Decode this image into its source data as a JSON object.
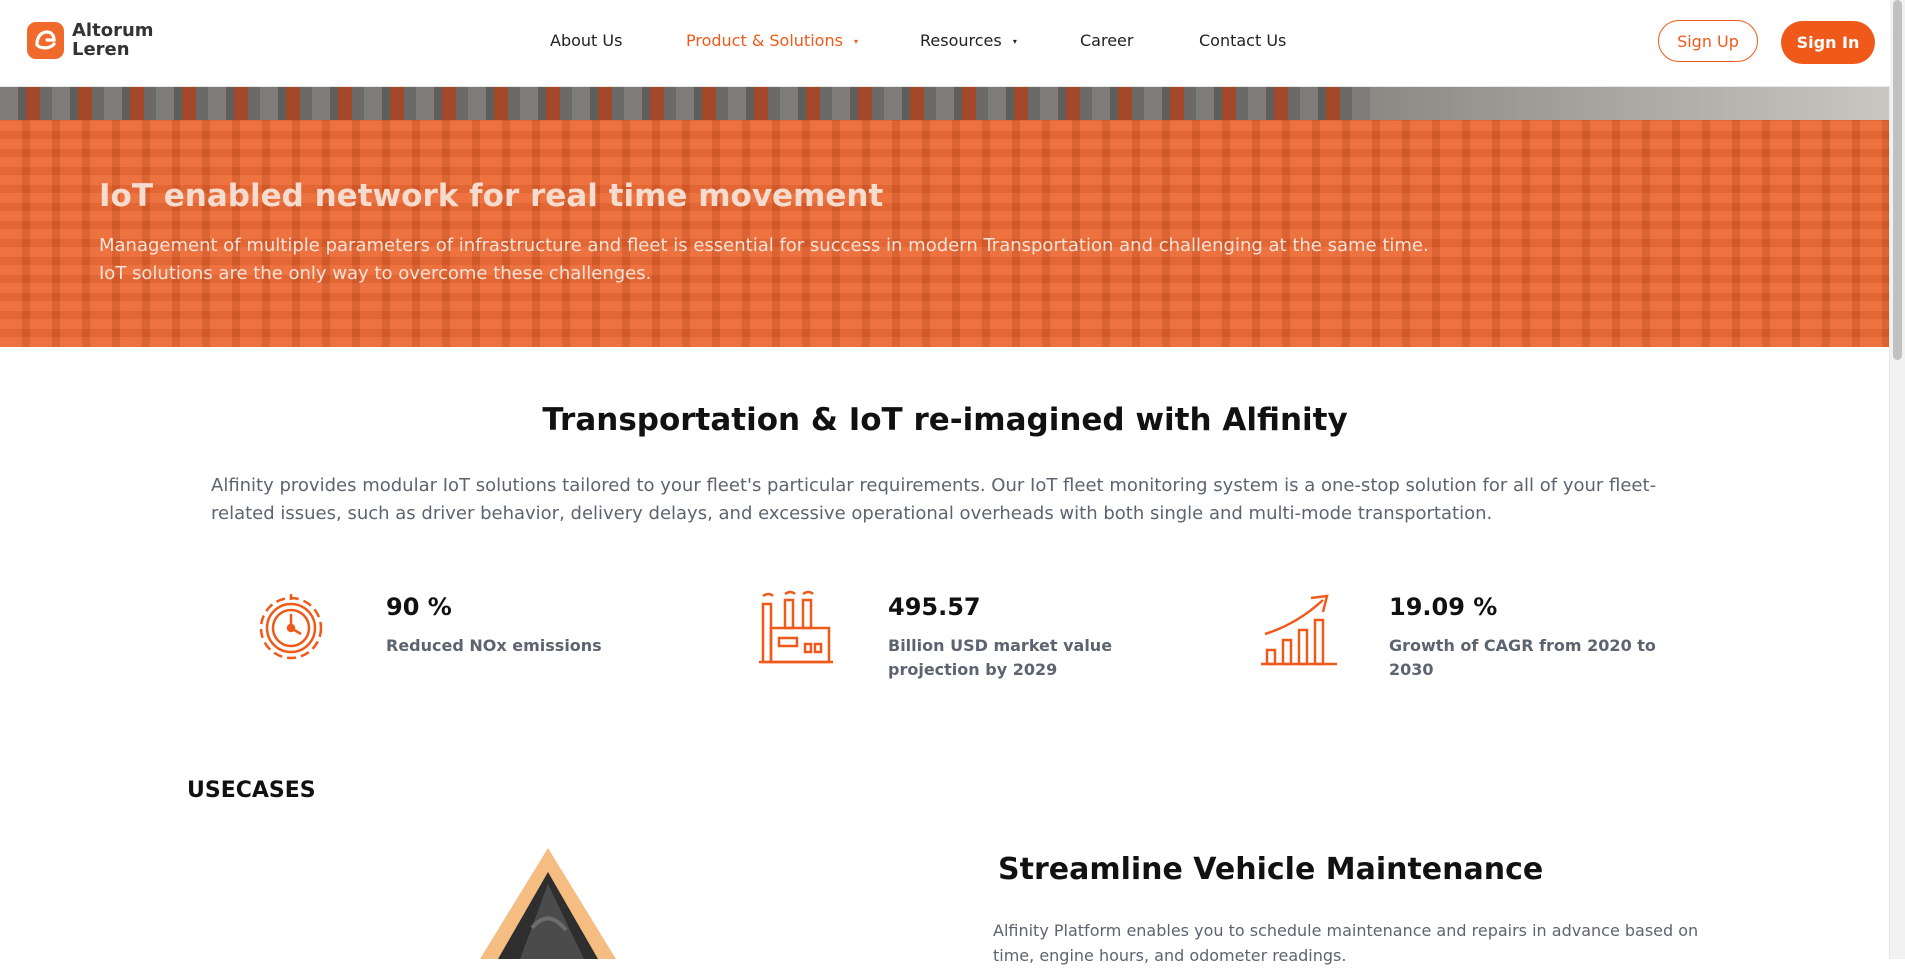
{
  "brand": {
    "line1": "Altorum",
    "line2": "Leren",
    "accent": "#ef5a1a"
  },
  "nav": {
    "items": [
      {
        "label": "About Us"
      },
      {
        "label": "Product & Solutions"
      },
      {
        "label": "Resources"
      },
      {
        "label": "Career"
      },
      {
        "label": "Contact Us"
      }
    ],
    "caret": "▾",
    "signup": "Sign Up",
    "signin": "Sign In"
  },
  "hero": {
    "title": "IoT enabled network for real time movement",
    "desc_line1": "Management of multiple parameters of infrastructure and fleet is essential for success in modern Transportation and challenging at the same time.",
    "desc_line2": "IoT solutions are the only way to overcome these challenges."
  },
  "intro": {
    "title": "Transportation & IoT re-imagined with Alfinity",
    "line1": "Alfinity provides modular IoT solutions tailored to your fleet's particular requirements. Our IoT fleet monitoring system is a one-stop solution for all of your fleet-",
    "line2": "related issues, such as driver behavior, delivery delays, and excessive operational overheads with both single and multi-mode transportation."
  },
  "stats": [
    {
      "icon": "gear-clock-icon",
      "value": "90 %",
      "label": "Reduced NOx emissions"
    },
    {
      "icon": "factory-icon",
      "value": "495.57",
      "label": "Billion USD market value projection by 2029"
    },
    {
      "icon": "growth-chart-icon",
      "value": "19.09 %",
      "label": "Growth of CAGR from 2020 to 2030"
    }
  ],
  "usecases": {
    "heading": "USECASES",
    "title": "Streamline Vehicle Maintenance",
    "desc_line1": "Alfinity Platform enables you to schedule maintenance and repairs in advance based on",
    "desc_line2": "time, engine hours, and odometer readings."
  }
}
